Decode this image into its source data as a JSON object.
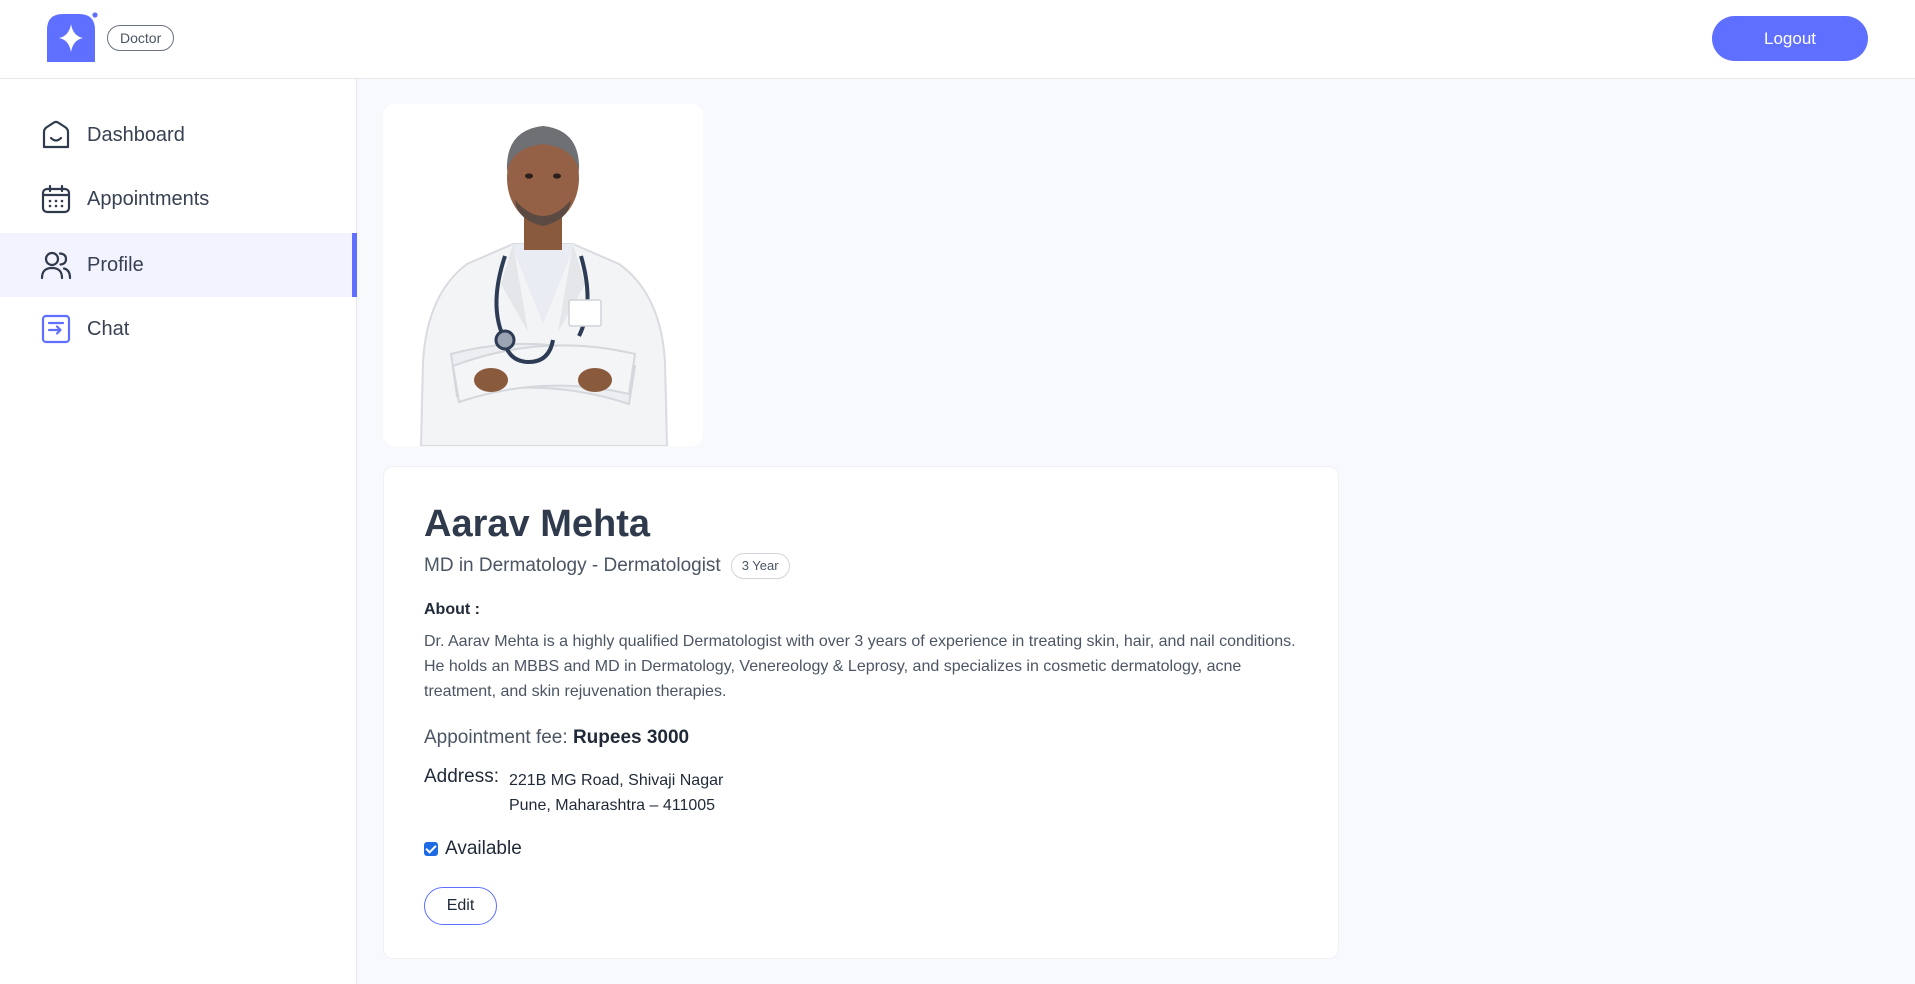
{
  "header": {
    "role_badge": "Doctor",
    "logout_label": "Logout",
    "accent_color": "#5f6fff"
  },
  "sidebar": {
    "items": [
      {
        "label": "Dashboard",
        "icon": "home-icon",
        "active": false
      },
      {
        "label": "Appointments",
        "icon": "calendar-icon",
        "active": false
      },
      {
        "label": "Profile",
        "icon": "people-icon",
        "active": true
      },
      {
        "label": "Chat",
        "icon": "chat-icon",
        "active": false
      }
    ]
  },
  "profile": {
    "photo": "doctor-portrait",
    "name": "Aarav Mehta",
    "degree": "MD in Dermatology - Dermatologist",
    "experience": "3 Year",
    "about_label": "About :",
    "about_text": "Dr. Aarav Mehta is a highly qualified Dermatologist with over 3 years of experience in treating skin, hair, and nail conditions. He holds an MBBS and MD in Dermatology, Venereology & Leprosy, and specializes in cosmetic dermatology, acne treatment, and skin rejuvenation therapies.",
    "fee_label": "Appointment fee:",
    "fee_value": "Rupees 3000",
    "address_label": "Address:",
    "address_line1": "221B MG Road, Shivaji Nagar",
    "address_line2": "Pune, Maharashtra – 411005",
    "available_label": "Available",
    "available": true,
    "edit_label": "Edit"
  }
}
